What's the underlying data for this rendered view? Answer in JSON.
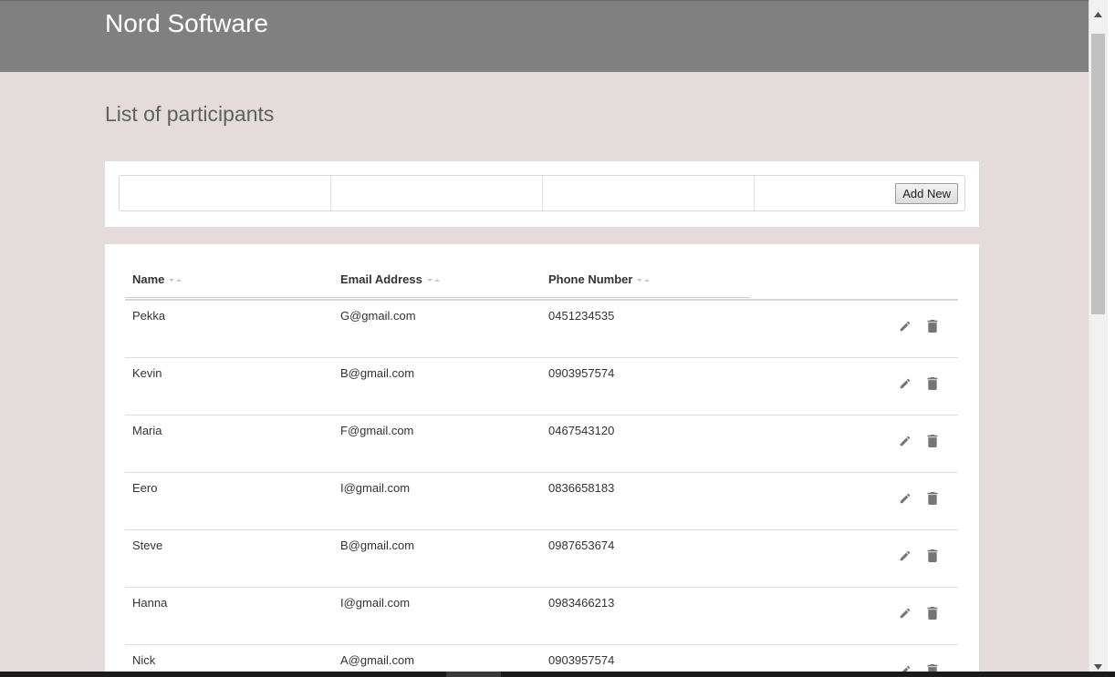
{
  "header": {
    "app_title": "Nord Software"
  },
  "page": {
    "title": "List of participants"
  },
  "add_form": {
    "fields": [
      {
        "name": "name",
        "value": "",
        "placeholder": ""
      },
      {
        "name": "email",
        "value": "",
        "placeholder": ""
      },
      {
        "name": "phone",
        "value": "",
        "placeholder": ""
      }
    ],
    "add_button_label": "Add New"
  },
  "table": {
    "columns": [
      "Name",
      "Email Address",
      "Phone Number"
    ],
    "rows": [
      {
        "name": "Pekka",
        "email": "G@gmail.com",
        "phone": "0451234535"
      },
      {
        "name": "Kevin",
        "email": "B@gmail.com",
        "phone": "0903957574"
      },
      {
        "name": "Maria",
        "email": "F@gmail.com",
        "phone": "0467543120"
      },
      {
        "name": "Eero",
        "email": "I@gmail.com",
        "phone": "0836658183"
      },
      {
        "name": "Steve",
        "email": "B@gmail.com",
        "phone": "0987653674"
      },
      {
        "name": "Hanna",
        "email": "I@gmail.com",
        "phone": "0983466213"
      },
      {
        "name": "Nick",
        "email": "A@gmail.com",
        "phone": "0903957574"
      }
    ],
    "row_action_icons": [
      "pencil-edit-icon",
      "trash-delete-icon"
    ]
  },
  "colors": {
    "header_bg": "#808080",
    "page_bg": "#e4dcdc",
    "card_bg": "#ffffff",
    "icon_gray": "#757575"
  }
}
